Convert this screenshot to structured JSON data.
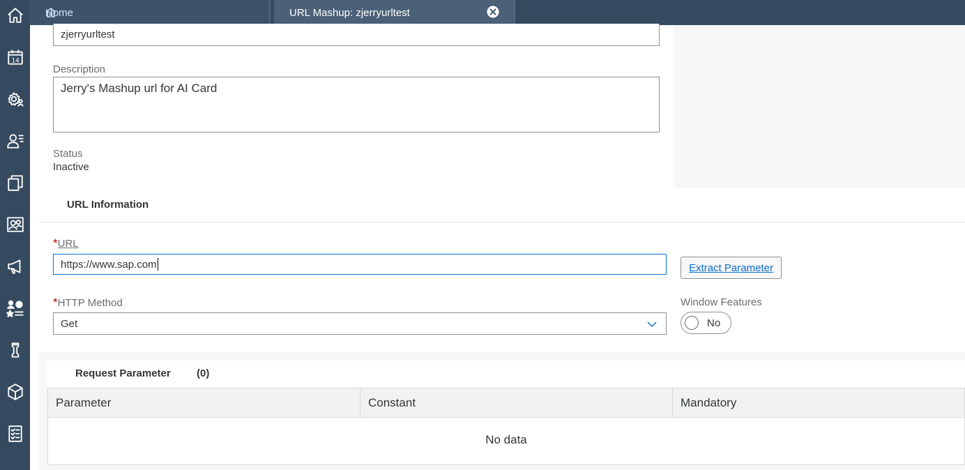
{
  "tabs": {
    "home_label": "Home",
    "active_label": "URL Mashup: zjerryurltest"
  },
  "form": {
    "name_value": "zjerryurltest",
    "description_label": "Description",
    "description_value": "Jerry's Mashup url for AI Card",
    "status_label": "Status",
    "status_value": "Inactive"
  },
  "url_section": {
    "title": "URL Information",
    "required_marker": "*",
    "url_label": "URL",
    "url_value": "https://www.sap.com",
    "extract_button": "Extract Parameter",
    "http_method_label": "HTTP Method",
    "http_method_value": "Get",
    "window_features_label": "Window Features",
    "window_features_value": "No"
  },
  "request_parameter": {
    "title": "Request Parameter",
    "count": "(0)",
    "columns": [
      "Parameter",
      "Constant",
      "Mandatory"
    ],
    "empty_text": "No data"
  },
  "rail_icons": [
    "home-icon",
    "calendar-icon",
    "settings-user-icon",
    "customer-icon",
    "copy-icon",
    "group-icon",
    "megaphone-icon",
    "people-rating-icon",
    "chess-icon",
    "product-icon",
    "checklist-icon"
  ],
  "colors": {
    "shell": "#354a5f",
    "accent": "#0a6ed1",
    "required": "#bb0000"
  }
}
